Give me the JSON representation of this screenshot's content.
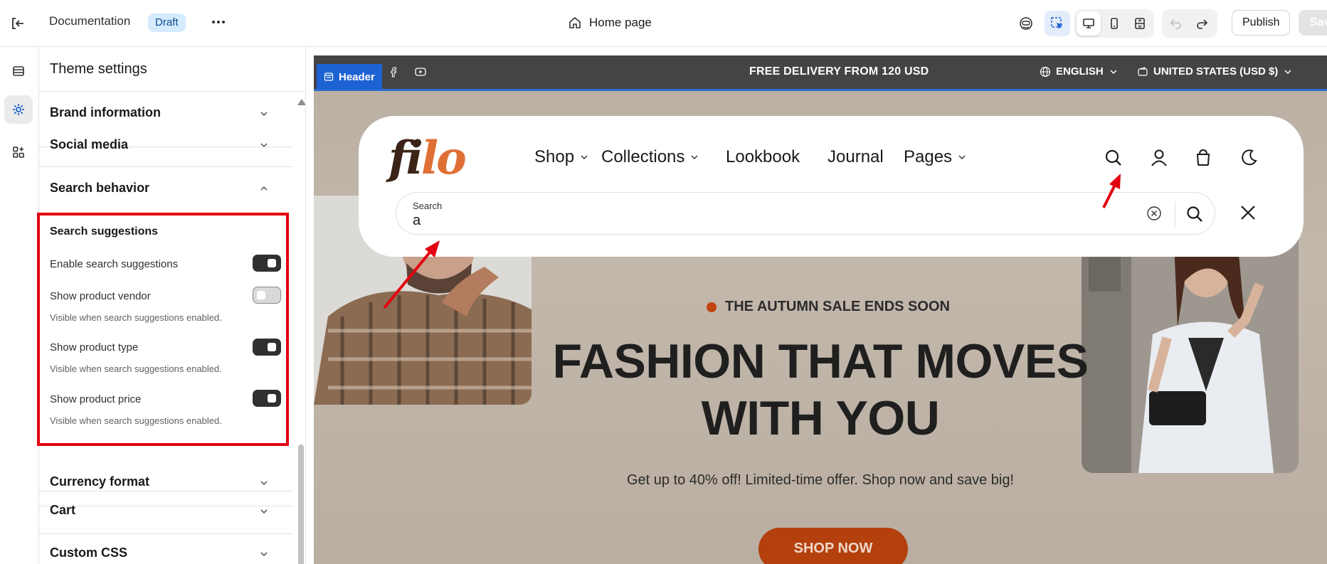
{
  "topbar": {
    "title": "Documentation",
    "status_badge": "Draft",
    "page_name": "Home page",
    "publish_label": "Publish",
    "save_label": "Save"
  },
  "panel": {
    "title": "Theme settings",
    "sections": [
      {
        "label": "Brand information",
        "expanded": false
      },
      {
        "label": "Social media",
        "expanded": false
      },
      {
        "label": "Search behavior",
        "expanded": true
      },
      {
        "label": "Currency format",
        "expanded": false
      },
      {
        "label": "Cart",
        "expanded": false
      },
      {
        "label": "Custom CSS",
        "expanded": false
      }
    ],
    "search": {
      "group_title": "Search suggestions",
      "options": [
        {
          "label": "Enable search suggestions",
          "enabled": true,
          "help": ""
        },
        {
          "label": "Show product vendor",
          "enabled": false,
          "help": "Visible when search suggestions enabled."
        },
        {
          "label": "Show product type",
          "enabled": true,
          "help": "Visible when search suggestions enabled."
        },
        {
          "label": "Show product price",
          "enabled": true,
          "help": "Visible when search suggestions enabled."
        }
      ]
    }
  },
  "preview": {
    "section_tag": "Header",
    "announcement": "FREE DELIVERY FROM 120 USD",
    "language": "ENGLISH",
    "currency": "UNITED STATES (USD $)",
    "logo": {
      "part1": "fi",
      "part2": "lo"
    },
    "nav": [
      {
        "label": "Shop",
        "has_dropdown": true
      },
      {
        "label": "Collections",
        "has_dropdown": true
      },
      {
        "label": "Lookbook",
        "has_dropdown": false
      },
      {
        "label": "Journal",
        "has_dropdown": false
      },
      {
        "label": "Pages",
        "has_dropdown": true
      }
    ],
    "search_label": "Search",
    "search_value": "a",
    "hero": {
      "eyebrow": "THE AUTUMN SALE ENDS SOON",
      "title_line1": "FASHION THAT MOVES",
      "title_line2": "WITH YOU",
      "subtitle": "Get up to 40% off! Limited-time offer. Shop now and save big!",
      "cta": "SHOP NOW"
    }
  },
  "colors": {
    "accent_blue": "#1c62d2",
    "annotation_red": "#e3000f",
    "logo_dark": "#3a2417",
    "logo_orange": "#e06f35",
    "cta": "#b3400d"
  }
}
